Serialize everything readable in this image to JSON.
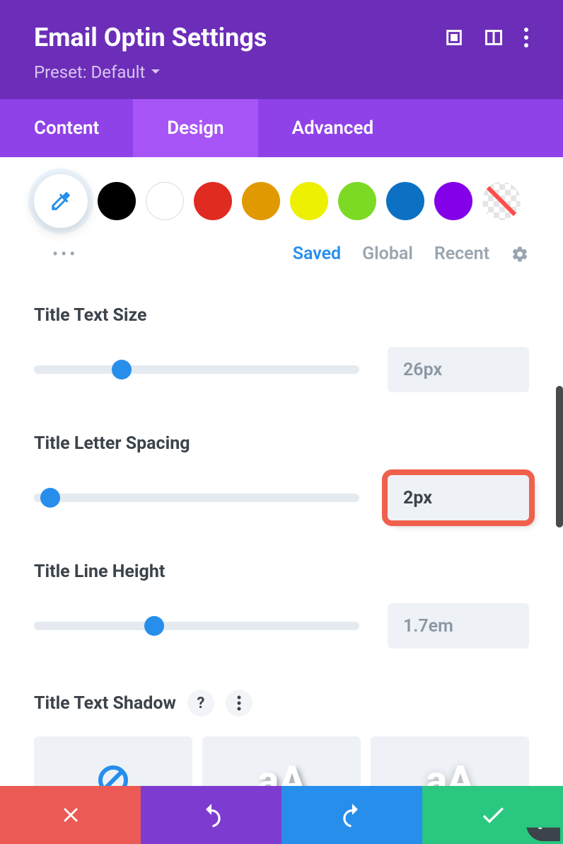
{
  "header": {
    "title": "Email Optin Settings",
    "preset": "Preset: Default"
  },
  "tabs": {
    "content": "Content",
    "design": "Design",
    "advanced": "Advanced",
    "active": "design"
  },
  "palette": {
    "colors": [
      "#000000",
      "#ffffff",
      "#e02b20",
      "#e09900",
      "#edf000",
      "#7cda24",
      "#0c71c3",
      "#8300e9"
    ],
    "tabs": {
      "saved": "Saved",
      "global": "Global",
      "recent": "Recent"
    }
  },
  "fields": {
    "textSize": {
      "label": "Title Text Size",
      "value": "26px",
      "thumb_pct": 27
    },
    "letterSpacing": {
      "label": "Title Letter Spacing",
      "value": "2px",
      "thumb_pct": 5,
      "highlight": true
    },
    "lineHeight": {
      "label": "Title Line Height",
      "value": "1.7em",
      "thumb_pct": 37
    },
    "textShadow": {
      "label": "Title Text Shadow"
    }
  }
}
